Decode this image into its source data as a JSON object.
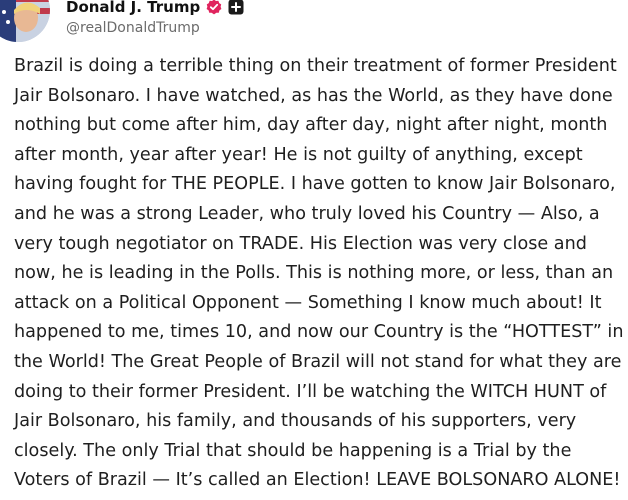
{
  "author": {
    "display_name": "Donald J. Trump",
    "handle": "@realDonaldTrump",
    "avatar_icon": "profile-avatar-icon",
    "verified_icon": "verified-badge-icon",
    "follow_icon": "add-plus-icon"
  },
  "post": {
    "text": "Brazil is doing a terrible thing on their treatment of former President Jair Bolsonaro. I have watched, as has the World, as they have done nothing but come after him, day after day, night after night, month after month, year after year! He is not guilty of anything, except having fought for THE PEOPLE. I have gotten to know Jair Bolsonaro, and he was a strong Leader, who truly loved his Country — Also, a very tough negotiator on TRADE. His Election was very close and now, he is leading in the Polls. This is nothing more, or less, than an attack on a Political Opponent — Something I know much about! It happened to me, times 10, and now our Country is the “HOTTEST” in the World! The Great People of Brazil will not stand for what they are doing to their former President. I’ll be watching the WITCH HUNT of Jair Bolsonaro, his family, and thousands of his supporters, very closely. The only Trial that should be happening is a Trial by the Voters of Brazil — It’s called an Election! LEAVE BOLSONARO ALONE!"
  },
  "colors": {
    "verified_badge": "#e0245e",
    "name_text": "#111111",
    "handle_text": "#6b6b6b",
    "body_text": "#1f1f1f"
  }
}
